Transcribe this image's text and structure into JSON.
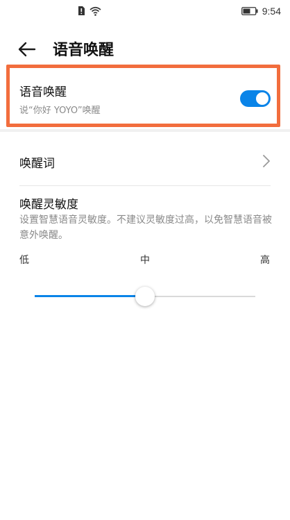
{
  "status_bar": {
    "time": "9:54",
    "icons": [
      "alert-sim-icon",
      "wifi-icon",
      "battery-icon"
    ]
  },
  "header": {
    "title": "语音唤醒",
    "back_icon": "arrow-left-icon"
  },
  "voice_wake": {
    "title": "语音唤醒",
    "subtitle": "说“你好 YOYO”唤醒",
    "enabled": true,
    "highlight_color": "#f26d3d"
  },
  "wake_word": {
    "label": "唤醒词",
    "chevron_icon": "chevron-right-icon"
  },
  "sensitivity": {
    "title": "唤醒灵敏度",
    "description": "设置智慧语音灵敏度。不建议灵敏度过高，以免智慧语音被意外唤醒。",
    "labels": {
      "low": "低",
      "mid": "中",
      "high": "高"
    },
    "value_fraction": 0.5
  },
  "colors": {
    "accent": "#0a84e8",
    "track": "#d9d9d9"
  }
}
